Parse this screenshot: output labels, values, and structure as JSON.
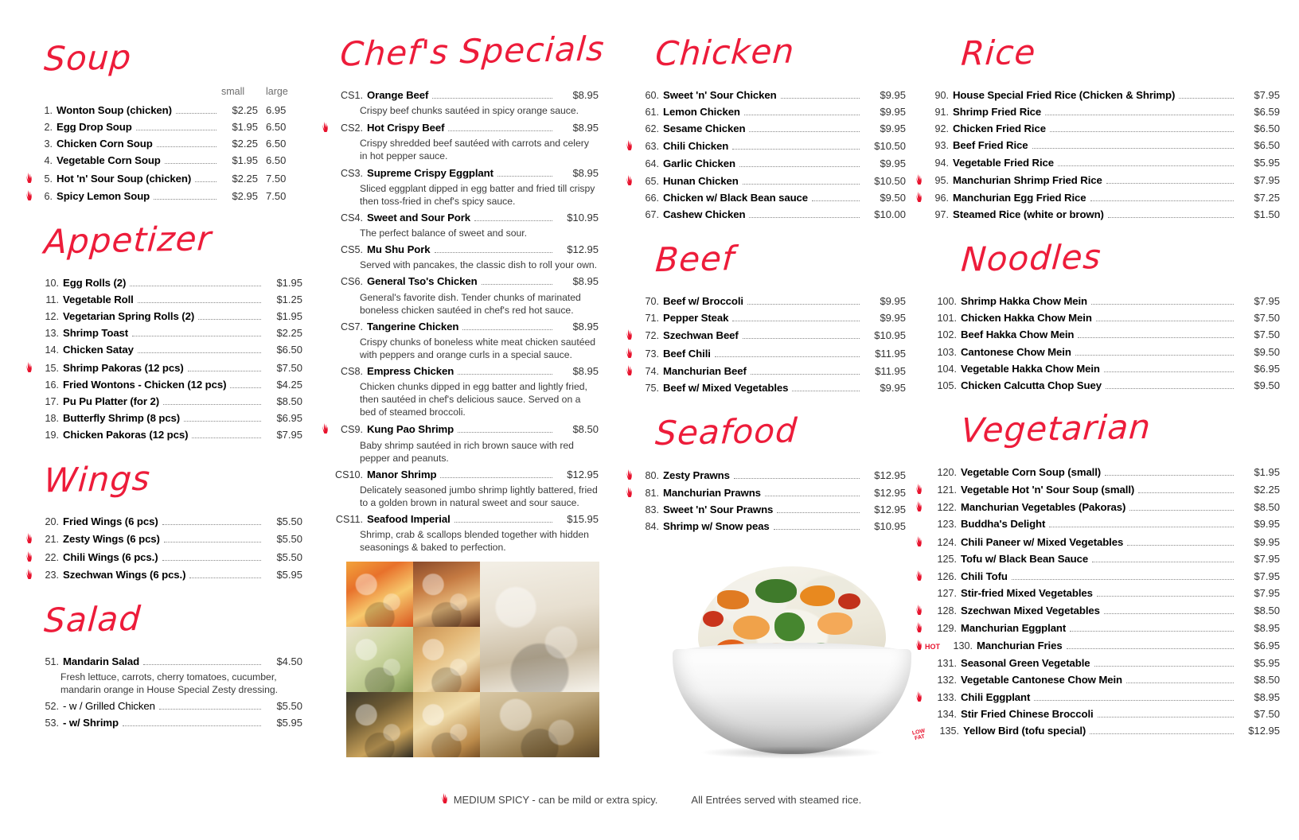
{
  "footer": {
    "spicy_note": "MEDIUM SPICY - can be mild or extra spicy.",
    "rice_note": "All Entrées served with steamed rice."
  },
  "badges": {
    "hot": "HOT",
    "low": "LOW",
    "fat": "FAT"
  },
  "columns": {
    "soup": {
      "title": "Soup",
      "header_small": "small",
      "header_large": "large",
      "items": [
        {
          "num": "1.",
          "name": "Wonton Soup  (chicken)",
          "price": "$2.25",
          "price2": "6.95",
          "spicy": false
        },
        {
          "num": "2.",
          "name": "Egg Drop Soup",
          "price": "$1.95",
          "price2": "6.50",
          "spicy": false
        },
        {
          "num": "3.",
          "name": "Chicken Corn Soup",
          "price": "$2.25",
          "price2": "6.50",
          "spicy": false
        },
        {
          "num": "4.",
          "name": "Vegetable Corn Soup",
          "price": "$1.95",
          "price2": "6.50",
          "spicy": false
        },
        {
          "num": "5.",
          "name": "Hot 'n' Sour Soup  (chicken)",
          "price": "$2.25",
          "price2": "7.50",
          "spicy": true
        },
        {
          "num": "6.",
          "name": "Spicy Lemon Soup",
          "price": "$2.95",
          "price2": "7.50",
          "spicy": true
        }
      ]
    },
    "appetizer": {
      "title": "Appetizer",
      "items": [
        {
          "num": "10.",
          "name": "Egg Rolls  (2)",
          "price": "$1.95",
          "spicy": false
        },
        {
          "num": "11.",
          "name": "Vegetable Roll",
          "price": "$1.25",
          "spicy": false
        },
        {
          "num": "12.",
          "name": "Vegetarian Spring Rolls  (2)",
          "price": "$1.95",
          "spicy": false
        },
        {
          "num": "13.",
          "name": "Shrimp Toast",
          "price": "$2.25",
          "spicy": false
        },
        {
          "num": "14.",
          "name": "Chicken Satay",
          "price": "$6.50",
          "spicy": false
        },
        {
          "num": "15.",
          "name": "Shrimp Pakoras  (12 pcs)",
          "price": "$7.50",
          "spicy": true
        },
        {
          "num": "16.",
          "name": "Fried Wontons - Chicken  (12 pcs)",
          "price": "$4.25",
          "spicy": false
        },
        {
          "num": "17.",
          "name": "Pu Pu Platter (for 2)",
          "price": "$8.50",
          "spicy": false
        },
        {
          "num": "18.",
          "name": "Butterfly Shrimp (8 pcs)",
          "price": "$6.95",
          "spicy": false
        },
        {
          "num": "19.",
          "name": "Chicken Pakoras (12 pcs)",
          "price": "$7.95",
          "spicy": false
        }
      ]
    },
    "wings": {
      "title": "Wings",
      "items": [
        {
          "num": "20.",
          "name": "Fried Wings  (6 pcs)",
          "price": "$5.50",
          "spicy": false
        },
        {
          "num": "21.",
          "name": "Zesty Wings  (6 pcs)",
          "price": "$5.50",
          "spicy": true
        },
        {
          "num": "22.",
          "name": "Chili Wings  (6 pcs.)",
          "price": "$5.50",
          "spicy": true
        },
        {
          "num": "23.",
          "name": "Szechwan Wings  (6 pcs.)",
          "price": "$5.95",
          "spicy": true
        }
      ]
    },
    "salad": {
      "title": "Salad",
      "items": [
        {
          "num": "51.",
          "name": "Mandarin Salad",
          "price": "$4.50",
          "spicy": false,
          "bold": true,
          "desc": "Fresh lettuce, carrots, cherry tomatoes, cucumber, mandarin orange in House Special Zesty dressing."
        },
        {
          "num": "52.",
          "name": "- w / Grilled Chicken",
          "price": "$5.50",
          "spicy": false,
          "bold": false
        },
        {
          "num": "53.",
          "name": "- w/ Shrimp",
          "price": "$5.95",
          "spicy": false,
          "bold": true
        }
      ]
    },
    "chefs_specials": {
      "title": "Chef's Specials",
      "items": [
        {
          "num": "CS1.",
          "name": "Orange Beef",
          "price": "$8.95",
          "spicy": false,
          "desc": "Crispy beef chunks sautéed in spicy orange sauce."
        },
        {
          "num": "CS2.",
          "name": "Hot Crispy Beef",
          "price": "$8.95",
          "spicy": true,
          "desc": "Crispy shredded beef sautéed with carrots and celery in hot pepper sauce."
        },
        {
          "num": "CS3.",
          "name": "Supreme Crispy Eggplant",
          "price": "$8.95",
          "spicy": false,
          "desc": "Sliced eggplant dipped in egg batter and fried till crispy then toss-fried in chef's spicy sauce."
        },
        {
          "num": "CS4.",
          "name": "Sweet and Sour Pork",
          "price": "$10.95",
          "spicy": false,
          "desc": "The perfect balance of sweet and sour."
        },
        {
          "num": "CS5.",
          "name": "Mu Shu Pork",
          "price": "$12.95",
          "spicy": false,
          "desc": "Served with pancakes, the classic dish to roll your own."
        },
        {
          "num": "CS6.",
          "name": "General Tso's Chicken",
          "price": "$8.95",
          "spicy": false,
          "desc": "General's favorite dish. Tender chunks of marinated boneless chicken sautéed in chef's red hot sauce."
        },
        {
          "num": "CS7.",
          "name": "Tangerine Chicken",
          "price": "$8.95",
          "spicy": false,
          "desc": "Crispy chunks of boneless white meat chicken sautéed with peppers and orange curls in a special sauce."
        },
        {
          "num": "CS8.",
          "name": "Empress Chicken",
          "price": "$8.95",
          "spicy": false,
          "desc": "Chicken chunks dipped in egg batter and lightly fried, then sautéed in chef's delicious sauce. Served on a bed of steamed broccoli."
        },
        {
          "num": "CS9.",
          "name": "Kung Pao Shrimp",
          "price": "$8.50",
          "spicy": true,
          "desc": "Baby shrimp sautéed in rich brown sauce with red pepper and peanuts."
        },
        {
          "num": "CS10.",
          "name": "Manor Shrimp",
          "price": "$12.95",
          "spicy": false,
          "desc": "Delicately seasoned jumbo shrimp lightly battered, fried to a golden brown in natural sweet and sour sauce."
        },
        {
          "num": "CS11.",
          "name": "Seafood Imperial",
          "price": "$15.95",
          "spicy": false,
          "desc": "Shrimp, crab & scallops blended together with hidden seasonings & baked to perfection."
        }
      ]
    },
    "chicken": {
      "title": "Chicken",
      "items": [
        {
          "num": "60.",
          "name": "Sweet 'n' Sour Chicken",
          "price": "$9.95",
          "spicy": false
        },
        {
          "num": "61.",
          "name": "Lemon Chicken",
          "price": "$9.95",
          "spicy": false
        },
        {
          "num": "62.",
          "name": "Sesame Chicken",
          "price": "$9.95",
          "spicy": false
        },
        {
          "num": "63.",
          "name": "Chili Chicken",
          "price": "$10.50",
          "spicy": true
        },
        {
          "num": "64.",
          "name": "Garlic Chicken",
          "price": "$9.95",
          "spicy": false
        },
        {
          "num": "65.",
          "name": "Hunan Chicken",
          "price": "$10.50",
          "spicy": true
        },
        {
          "num": "66.",
          "name": "Chicken w/ Black Bean sauce",
          "price": "$9.50",
          "spicy": false
        },
        {
          "num": "67.",
          "name": "Cashew Chicken",
          "price": "$10.00",
          "spicy": false
        }
      ]
    },
    "beef": {
      "title": "Beef",
      "items": [
        {
          "num": "70.",
          "name": "Beef w/ Broccoli",
          "price": "$9.95",
          "spicy": false
        },
        {
          "num": "71.",
          "name": "Pepper Steak",
          "price": "$9.95",
          "spicy": false
        },
        {
          "num": "72.",
          "name": "Szechwan Beef",
          "price": "$10.95",
          "spicy": true
        },
        {
          "num": "73.",
          "name": "Beef Chili",
          "price": "$11.95",
          "spicy": true
        },
        {
          "num": "74.",
          "name": "Manchurian Beef",
          "price": "$11.95",
          "spicy": true
        },
        {
          "num": "75.",
          "name": "Beef w/ Mixed Vegetables",
          "price": "$9.95",
          "spicy": false
        }
      ]
    },
    "seafood": {
      "title": "Seafood",
      "items": [
        {
          "num": "80.",
          "name": "Zesty Prawns",
          "price": "$12.95",
          "spicy": true
        },
        {
          "num": "81.",
          "name": "Manchurian Prawns",
          "price": "$12.95",
          "spicy": true
        },
        {
          "num": "83.",
          "name": "Sweet 'n' Sour Prawns",
          "price": "$12.95",
          "spicy": false
        },
        {
          "num": "84.",
          "name": "Shrimp w/ Snow peas",
          "price": "$10.95",
          "spicy": false
        }
      ]
    },
    "rice": {
      "title": "Rice",
      "items": [
        {
          "num": "90.",
          "name": "House Special Fried Rice  (Chicken & Shrimp)",
          "price": "$7.95",
          "spicy": false
        },
        {
          "num": "91.",
          "name": "Shrimp Fried Rice",
          "price": "$6.59",
          "spicy": false
        },
        {
          "num": "92.",
          "name": "Chicken Fried Rice",
          "price": "$6.50",
          "spicy": false
        },
        {
          "num": "93.",
          "name": "Beef Fried Rice",
          "price": "$6.50",
          "spicy": false
        },
        {
          "num": "94.",
          "name": "Vegetable Fried Rice",
          "price": "$5.95",
          "spicy": false
        },
        {
          "num": "95.",
          "name": "Manchurian Shrimp Fried Rice",
          "price": "$7.95",
          "spicy": true
        },
        {
          "num": "96.",
          "name": "Manchurian Egg Fried Rice",
          "price": "$7.25",
          "spicy": true
        },
        {
          "num": "97.",
          "name": "Steamed Rice  (white or brown)",
          "price": "$1.50",
          "spicy": false
        }
      ]
    },
    "noodles": {
      "title": "Noodles",
      "items": [
        {
          "num": "100.",
          "name": "Shrimp Hakka Chow Mein",
          "price": "$7.95",
          "spicy": false
        },
        {
          "num": "101.",
          "name": "Chicken Hakka Chow Mein",
          "price": "$7.50",
          "spicy": false
        },
        {
          "num": "102.",
          "name": "Beef Hakka Chow Mein",
          "price": "$7.50",
          "spicy": false
        },
        {
          "num": "103.",
          "name": "Cantonese Chow Mein",
          "price": "$9.50",
          "spicy": false
        },
        {
          "num": "104.",
          "name": "Vegetable Hakka Chow Mein",
          "price": "$6.95",
          "spicy": false
        },
        {
          "num": "105.",
          "name": "Chicken Calcutta Chop Suey",
          "price": "$9.50",
          "spicy": false
        }
      ]
    },
    "vegetarian": {
      "title": "Vegetarian",
      "items": [
        {
          "num": "120.",
          "name": "Vegetable Corn Soup  (small)",
          "price": "$1.95",
          "spicy": false
        },
        {
          "num": "121.",
          "name": "Vegetable Hot 'n' Sour Soup  (small)",
          "price": "$2.25",
          "spicy": true
        },
        {
          "num": "122.",
          "name": "Manchurian Vegetables  (Pakoras)",
          "price": "$8.50",
          "spicy": true
        },
        {
          "num": "123.",
          "name": "Buddha's Delight",
          "price": "$9.95",
          "spicy": false
        },
        {
          "num": "124.",
          "name": "Chili Paneer w/ Mixed Vegetables",
          "price": "$9.95",
          "spicy": true
        },
        {
          "num": "125.",
          "name": "Tofu w/ Black Bean Sauce",
          "price": "$7.95",
          "spicy": false
        },
        {
          "num": "126.",
          "name": "Chili Tofu",
          "price": "$7.95",
          "spicy": true
        },
        {
          "num": "127.",
          "name": "Stir-fried Mixed Vegetables",
          "price": "$7.95",
          "spicy": false
        },
        {
          "num": "128.",
          "name": "Szechwan Mixed Vegetables",
          "price": "$8.50",
          "spicy": true
        },
        {
          "num": "129.",
          "name": "Manchurian Eggplant",
          "price": "$8.95",
          "spicy": true
        },
        {
          "num": "130.",
          "name": "Manchurian Fries",
          "price": "$6.95",
          "spicy": true,
          "badge": "hot"
        },
        {
          "num": "131.",
          "name": "Seasonal Green Vegetable",
          "price": "$5.95",
          "spicy": false
        },
        {
          "num": "132.",
          "name": "Vegetable Cantonese Chow Mein",
          "price": "$8.50",
          "spicy": false
        },
        {
          "num": "133.",
          "name": "Chili Eggplant",
          "price": "$8.95",
          "spicy": true
        },
        {
          "num": "134.",
          "name": "Stir Fried Chinese Broccoli",
          "price": "$7.50",
          "spicy": false
        },
        {
          "num": "135.",
          "name": "Yellow Bird  (tofu special)",
          "price": "$12.95",
          "spicy": false,
          "badge": "lowfat"
        }
      ]
    }
  }
}
